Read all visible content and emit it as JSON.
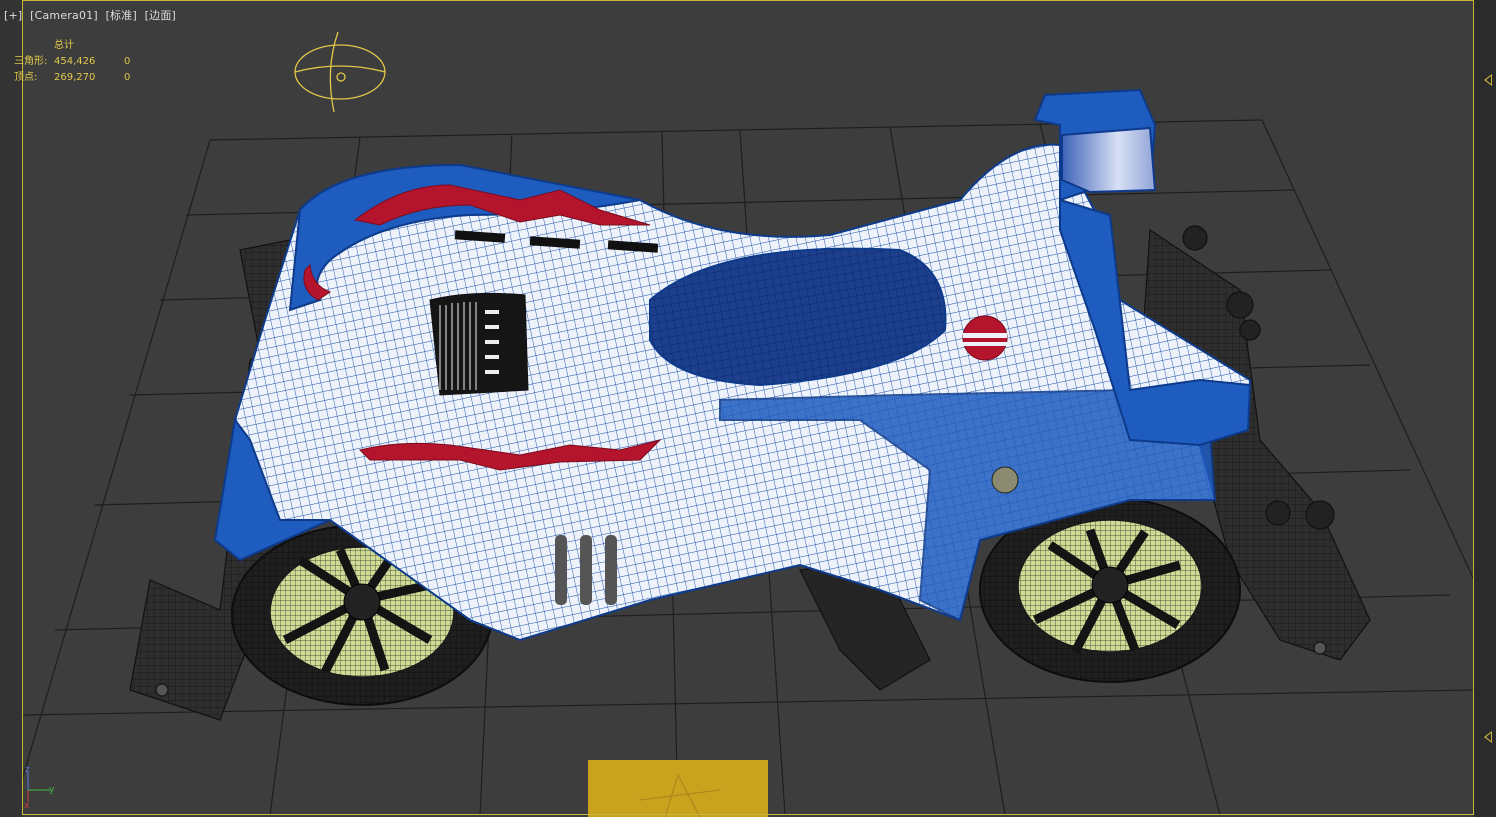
{
  "viewport": {
    "label_plus": "[+]",
    "label_camera": "[Camera01]",
    "label_shading": "[标准]",
    "label_edges": "[边面]"
  },
  "stats": {
    "header": "总计",
    "rows": [
      {
        "label": "三角形:",
        "value": "454,426",
        "selected": "0"
      },
      {
        "label": "顶点:",
        "value": "269,270",
        "selected": "0"
      }
    ]
  },
  "axis": {
    "z": "z",
    "y": "y",
    "x": "x"
  },
  "colors": {
    "viewport_bg": "#3d3d3d",
    "grid": "#1e1e1e",
    "active_border": "#c9b53a",
    "stats_text": "#e0c84a",
    "car_blue": "#1f5fc0",
    "car_stripe": "#b4152c",
    "chassis": "#2c2c2c",
    "wheel_hub": "#d7e4a0"
  },
  "icons": [
    "viewcube-icon",
    "axis-tripod-icon",
    "panel-collapse-icon"
  ]
}
